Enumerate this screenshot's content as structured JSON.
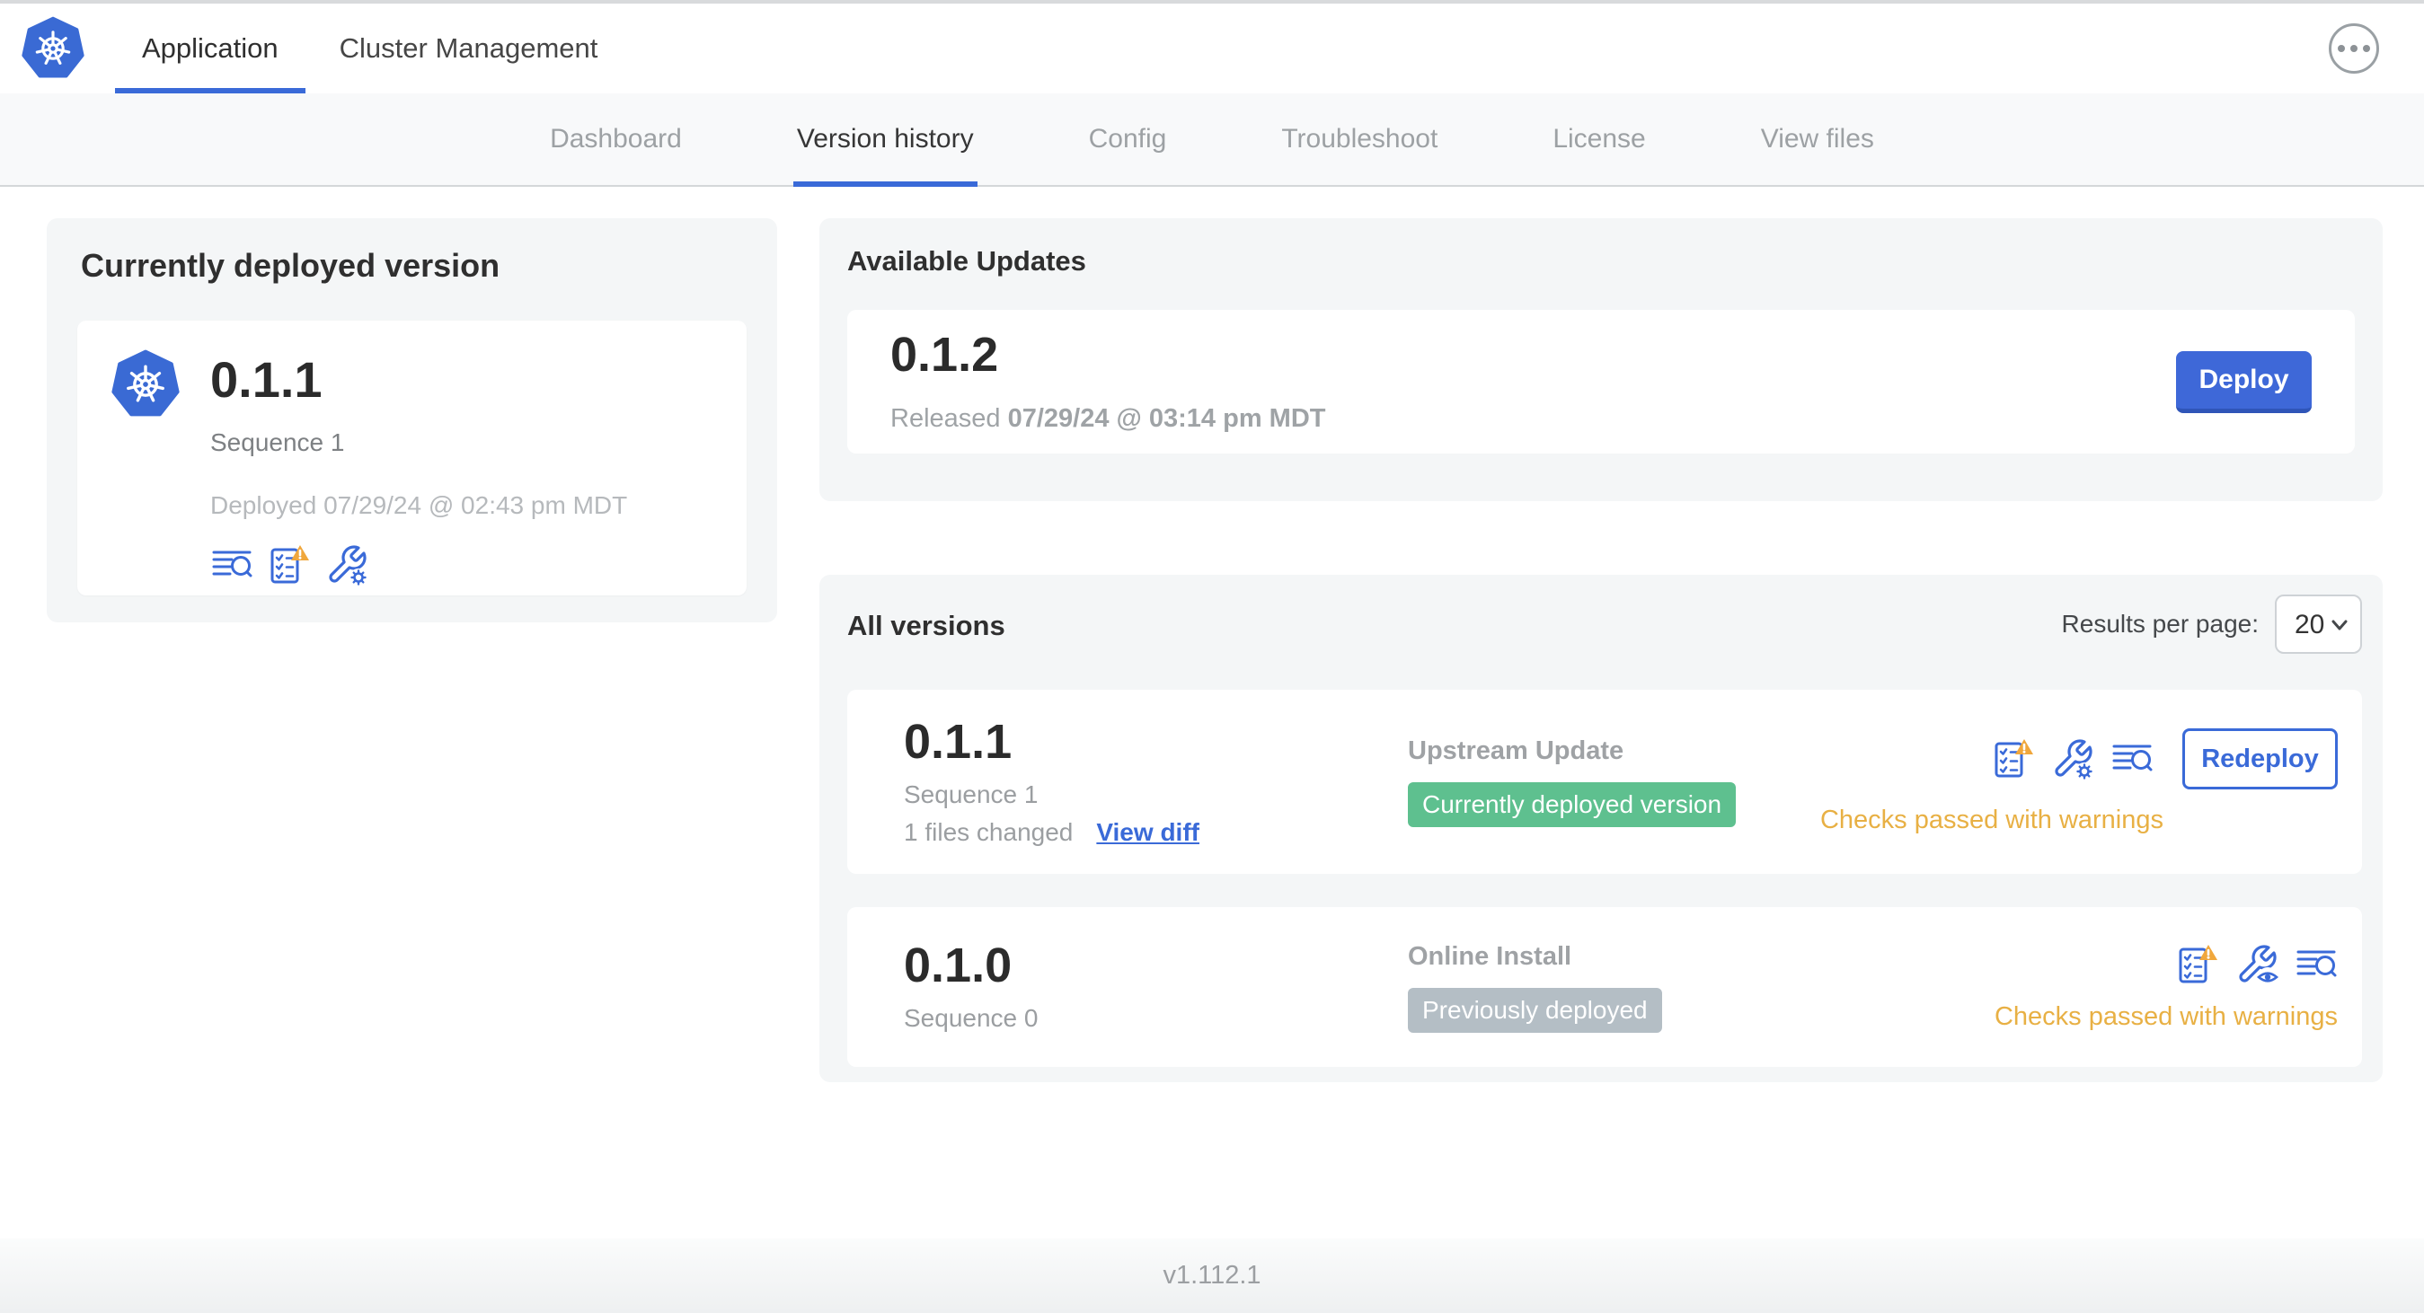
{
  "colors": {
    "accent": "#3a6ad8",
    "button-blue": "#3e68d8",
    "button-blue-dark": "#2f55b8",
    "badge-green": "#5ec08f",
    "badge-gray": "#b4bec5",
    "warning-amber": "#e8b044",
    "warning-triangle": "#f0a73c",
    "logo-blue": "#3a6ad4"
  },
  "header": {
    "tabs": [
      {
        "label": "Application"
      },
      {
        "label": "Cluster Management"
      }
    ]
  },
  "subnav": {
    "items": [
      "Dashboard",
      "Version history",
      "Config",
      "Troubleshoot",
      "License",
      "View files"
    ]
  },
  "current": {
    "title": "Currently deployed version",
    "version": "0.1.1",
    "sequence": "Sequence 1",
    "deployed": "Deployed 07/29/24 @ 02:43 pm MDT"
  },
  "updates": {
    "title": "Available Updates",
    "version": "0.1.2",
    "released_label": "Released",
    "released_value": "07/29/24 @ 03:14 pm MDT",
    "deploy_button": "Deploy"
  },
  "all_versions": {
    "title": "All versions",
    "results_label": "Results per page:",
    "results_value": "20",
    "rows": [
      {
        "version": "0.1.1",
        "sequence": "Sequence 1",
        "files_changed": "1 files changed",
        "view_diff": "View diff",
        "source": "Upstream Update",
        "badge": "Currently deployed version",
        "action": "Redeploy",
        "status": "Checks passed with warnings"
      },
      {
        "version": "0.1.0",
        "sequence": "Sequence 0",
        "source": "Online Install",
        "badge": "Previously deployed",
        "status": "Checks passed with warnings"
      }
    ]
  },
  "footer": {
    "app_version": "v1.112.1"
  }
}
